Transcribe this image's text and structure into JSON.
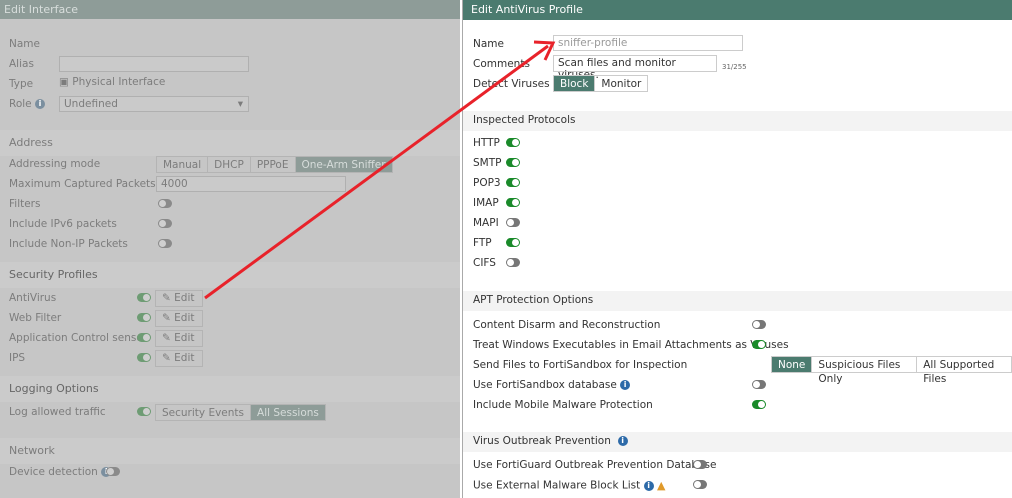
{
  "left": {
    "title": "Edit Interface",
    "name_label": "Name",
    "alias_label": "Alias",
    "alias_value": "",
    "type_label": "Type",
    "type_value": "Physical Interface",
    "role_label": "Role",
    "role_value": "Undefined",
    "address": {
      "heading": "Address",
      "mode_label": "Addressing mode",
      "modes": [
        "Manual",
        "DHCP",
        "PPPoE",
        "One-Arm Sniffer"
      ],
      "selected_mode": "One-Arm Sniffer",
      "max_label": "Maximum Captured Packets",
      "max_value": "4000",
      "filters_label": "Filters",
      "ipv6_label": "Include IPv6 packets",
      "nonip_label": "Include Non-IP Packets"
    },
    "security": {
      "heading": "Security Profiles",
      "edit_label": "Edit",
      "items": [
        {
          "label": "AntiVirus",
          "on": true
        },
        {
          "label": "Web Filter",
          "on": true
        },
        {
          "label": "Application Control sensor",
          "on": true
        },
        {
          "label": "IPS",
          "on": true
        }
      ]
    },
    "logging": {
      "heading": "Logging Options",
      "label": "Log allowed traffic",
      "options": [
        "Security Events",
        "All Sessions"
      ],
      "selected": "All Sessions"
    },
    "network": {
      "heading": "Network",
      "device_label": "Device detection"
    }
  },
  "right": {
    "title": "Edit AntiVirus Profile",
    "name_label": "Name",
    "name_value": "sniffer-profile",
    "comments_label": "Comments",
    "comments_value": "Scan files and monitor viruses.",
    "comments_count": "31/255",
    "detect_label": "Detect Viruses",
    "detect_options": [
      "Block",
      "Monitor"
    ],
    "detect_selected": "Block",
    "protocols": {
      "heading": "Inspected Protocols",
      "items": [
        {
          "label": "HTTP",
          "on": true
        },
        {
          "label": "SMTP",
          "on": true
        },
        {
          "label": "POP3",
          "on": true
        },
        {
          "label": "IMAP",
          "on": true
        },
        {
          "label": "MAPI",
          "on": false
        },
        {
          "label": "FTP",
          "on": true
        },
        {
          "label": "CIFS",
          "on": false
        }
      ]
    },
    "apt": {
      "heading": "APT Protection Options",
      "cdr": "Content Disarm and Reconstruction",
      "treat": "Treat Windows Executables in Email Attachments as Viruses",
      "send": "Send Files to FortiSandbox for Inspection",
      "send_options": [
        "None",
        "Suspicious Files Only",
        "All Supported Files"
      ],
      "send_selected": "None",
      "usedb": "Use FortiSandbox database",
      "mobile": "Include Mobile Malware Protection"
    },
    "outbreak": {
      "heading": "Virus Outbreak Prevention",
      "fortiguard": "Use FortiGuard Outbreak Prevention Database",
      "external": "Use External Malware Block List"
    }
  },
  "colors": {
    "accent": "#4b7b6f",
    "toggle_on": "#1a8a2a",
    "arrow": "#e8222a"
  }
}
